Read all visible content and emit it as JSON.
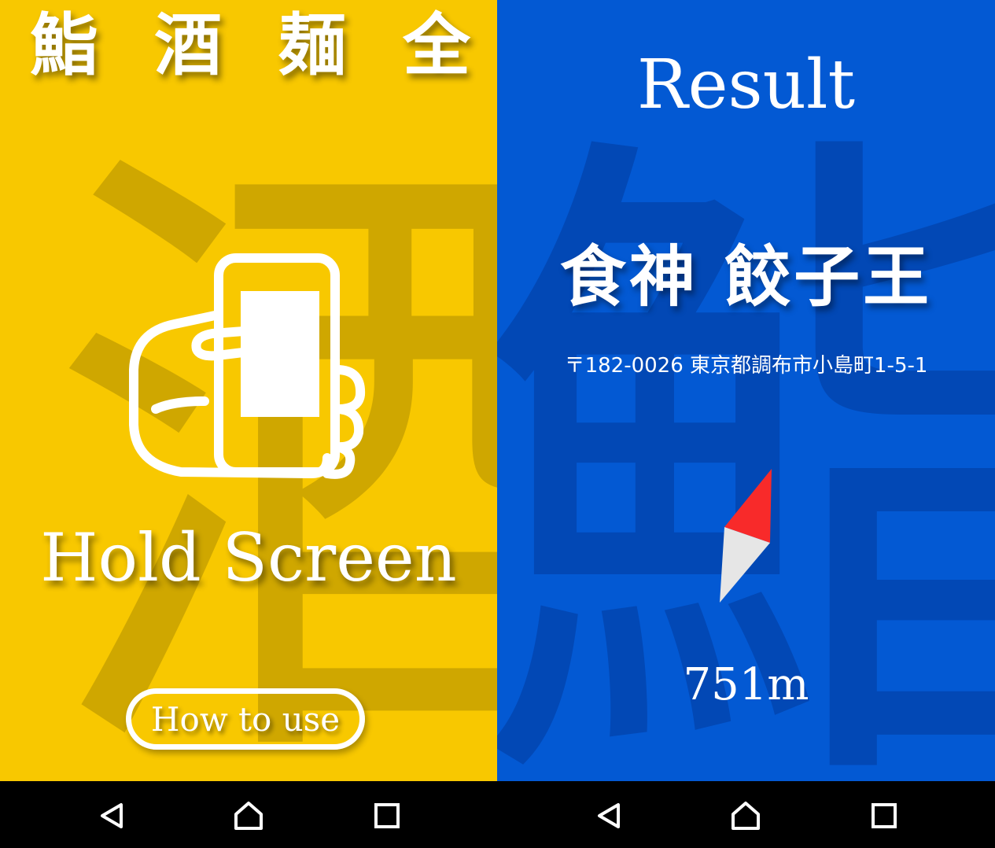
{
  "left_screen": {
    "tabs": [
      "鮨",
      "酒",
      "麺",
      "全"
    ],
    "background_kanji": "酒",
    "hold_label": "Hold Screen",
    "howto_label": "How to use",
    "icon": "hand-holding-phone-icon",
    "colors": {
      "background": "#f8c800",
      "watermark": "#cfa700"
    }
  },
  "right_screen": {
    "title": "Result",
    "background_kanji": "鮨",
    "shop_name": "食神 餃子王",
    "address": "〒182-0026 東京都調布市小島町1-5-1",
    "distance": "751m",
    "icon": "compass-needle-icon",
    "colors": {
      "background": "#0359d3",
      "watermark": "#0248b5",
      "needle_north": "#f82a2a",
      "needle_south": "#e6e6e6"
    }
  },
  "navbar": {
    "buttons": [
      "back-icon",
      "home-icon",
      "recents-icon"
    ]
  }
}
